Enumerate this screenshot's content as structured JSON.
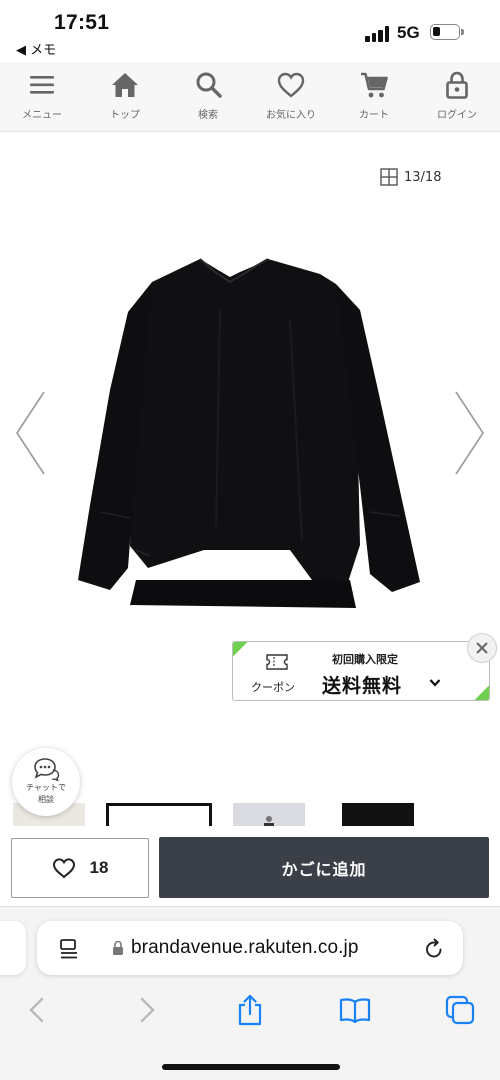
{
  "status_bar": {
    "time": "17:51",
    "back_app": "◀ メモ",
    "network": "5G"
  },
  "nav": {
    "items": [
      {
        "label": "メニュー",
        "icon": "menu-icon"
      },
      {
        "label": "トップ",
        "icon": "home-icon"
      },
      {
        "label": "検索",
        "icon": "search-icon"
      },
      {
        "label": "お気に入り",
        "icon": "heart-icon"
      },
      {
        "label": "カート",
        "icon": "cart-icon"
      },
      {
        "label": "ログイン",
        "icon": "lock-icon"
      }
    ]
  },
  "gallery": {
    "counter": "13/18",
    "image_subject": "black long-sleeve blouse"
  },
  "coupon": {
    "label": "クーポン",
    "limit_text": "初回購入限定",
    "offer_text": "送料無料",
    "accent_color": "#6fcf4f"
  },
  "chat": {
    "label_line1": "チャットで",
    "label_line2": "相談"
  },
  "actions": {
    "favorite_count": "18",
    "add_to_cart": "かごに追加",
    "cart_button_color": "#3b3f48"
  },
  "browser": {
    "url": "brandavenue.rakuten.co.jp",
    "accent_color": "#1a82f7"
  }
}
